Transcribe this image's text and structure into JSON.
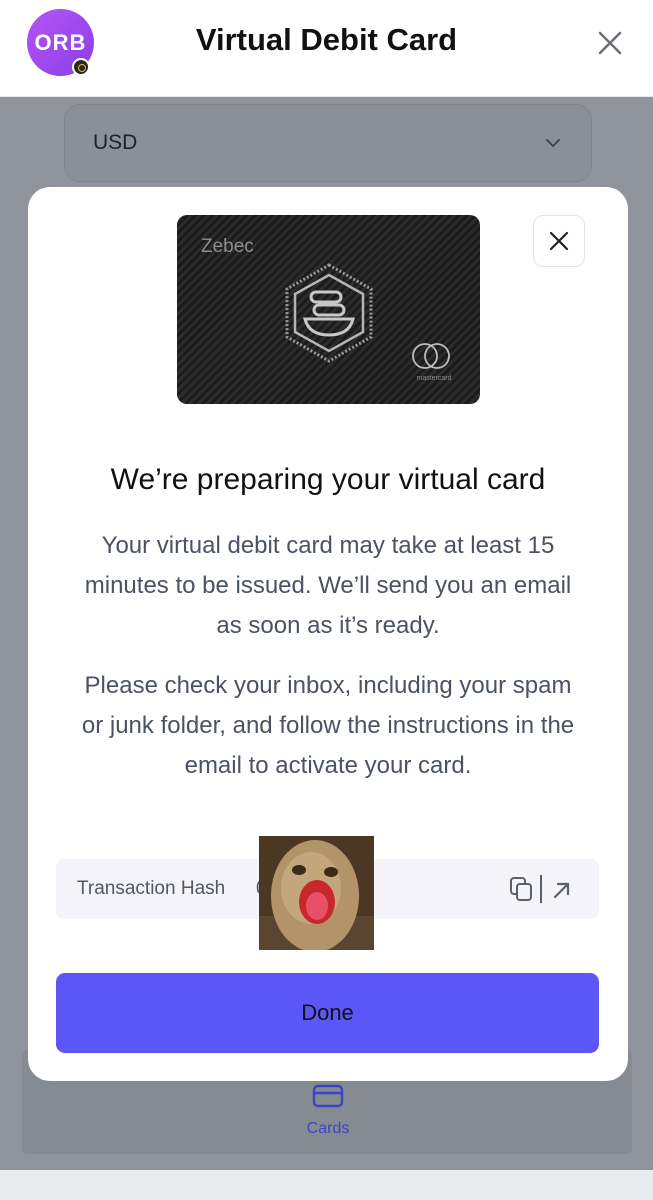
{
  "header": {
    "avatar_text": "ORB",
    "title": "Virtual Debit Card",
    "close_icon": "close-icon"
  },
  "currency": {
    "value": "USD",
    "icon": "chevron-down-icon"
  },
  "modal": {
    "card": {
      "brand": "Zebec",
      "network_label": "mastercard"
    },
    "close_icon": "close-icon",
    "title": "We’re preparing your virtual card",
    "paragraph1": "Your virtual debit card may take at least 15 minutes to be issued. We’ll send you an email as soon as it’s ready.",
    "paragraph2": "Please check your inbox, including your spam or junk folder, and follow the instructions in the email to activate your card.",
    "transaction_hash": {
      "label": "Transaction Hash",
      "value": "0"
    },
    "done_label": "Done"
  },
  "nav": {
    "cards_label": "Cards",
    "cards_icon": "card-icon"
  },
  "colors": {
    "accent": "#5b57f7",
    "nav_active": "#3b44c9",
    "avatar": "#a64bf1",
    "overlay": "#8f949c"
  }
}
